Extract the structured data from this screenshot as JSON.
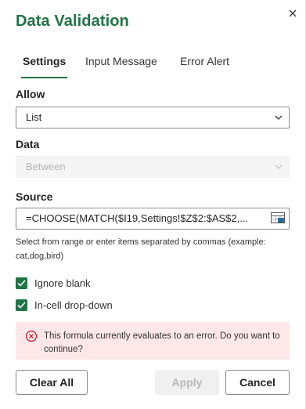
{
  "dialog": {
    "title": "Data Validation",
    "tabs": [
      {
        "label": "Settings",
        "active": true
      },
      {
        "label": "Input Message",
        "active": false
      },
      {
        "label": "Error Alert",
        "active": false
      }
    ],
    "allow": {
      "label": "Allow",
      "value": "List"
    },
    "data": {
      "label": "Data",
      "value": "Between",
      "disabled": true
    },
    "source": {
      "label": "Source",
      "value": "=CHOOSE(MATCH($I19,Settings!$Z$2:$AS$2,...",
      "hint": "Select from range or enter items separated by commas (example: cat,dog,bird)"
    },
    "checkboxes": [
      {
        "label": "Ignore blank",
        "checked": true
      },
      {
        "label": "In-cell drop-down",
        "checked": true
      }
    ],
    "error_message": "This formula currently evaluates to an error. Do you want to continue?",
    "buttons": {
      "clear_all": "Clear All",
      "apply": "Apply",
      "cancel": "Cancel"
    }
  },
  "colors": {
    "accent": "#217346",
    "error_bg": "#fde7e9",
    "error_icon": "#c50f1f"
  },
  "icons": {
    "close": "close-icon",
    "dropdown": "chevron-down-icon",
    "range_selector": "range-select-icon",
    "check": "checkmark-icon",
    "error": "error-circle-icon"
  }
}
